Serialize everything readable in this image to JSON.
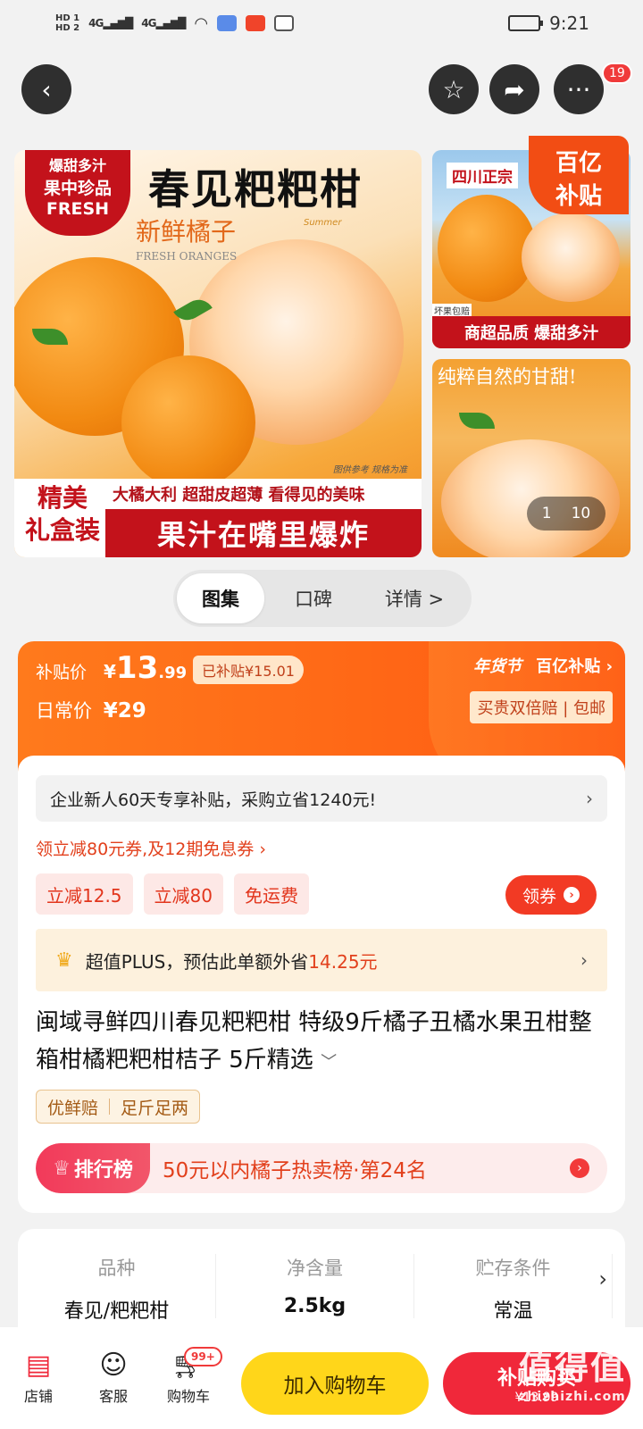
{
  "status_bar": {
    "time": "9:21",
    "network": "4G",
    "hd1": "HD 1",
    "hd2": "HD 2"
  },
  "top_bar": {
    "notification_count": "19"
  },
  "gallery": {
    "main_image": {
      "title": "春见粑粑柑",
      "corner_tag_line1": "爆甜多汁",
      "corner_tag_line2": "果中珍品",
      "corner_tag_line3": "FRESH",
      "box_text": "新鲜橘子",
      "box_subtext": "FRESH ORANGES",
      "sun_label": "Summer",
      "slogan_small": "大橘大利 超甜皮超薄 看得见的美味",
      "slogan_big": "果汁在嘴里爆炸",
      "gift_line1": "精美",
      "gift_line2": "礼盒装",
      "disclaimer": "图供参考 规格为准"
    },
    "side_image_1": {
      "top_text": "四川正宗",
      "bottom_text": "商超品质 爆甜多汁",
      "small_label": "坏果包赔"
    },
    "side_image_2": {
      "top_text": "纯粹自然的甘甜!"
    },
    "subsidy_corner": {
      "line1": "百亿",
      "line2": "补贴"
    },
    "counter_current": "1",
    "counter_total": "10"
  },
  "tabs": {
    "items": [
      "图集",
      "口碑",
      "详情 >"
    ]
  },
  "price": {
    "subsidy_label": "补贴价",
    "currency": "¥",
    "price_int": "13",
    "price_dec": ".99",
    "subsidized": "已补贴¥15.01",
    "daily_label": "日常价",
    "daily_price": "¥29",
    "festival": "年货节",
    "program": "百亿补贴",
    "guarantee": "买贵双倍赔 | 包邮"
  },
  "offers": {
    "newcomer": "企业新人60天专享补贴，采购立省1240元!",
    "coupon_line": "领立减80元券,及12期免息券 ›",
    "chips": [
      "立减12.5",
      "立减80",
      "免运费"
    ],
    "get_coupon": "领券",
    "plus_text": "超值PLUS，预估此单额外省",
    "plus_amount": "14.25元"
  },
  "product": {
    "title": "闽域寻鲜四川春见粑粑柑 特级9斤橘子丑橘水果丑柑整箱柑橘粑粑柑桔子 5斤精选",
    "tags": [
      "优鲜赔",
      "足斤足两"
    ],
    "rank_label": "排行榜",
    "rank_text": "50元以内橘子热卖榜·第24名"
  },
  "specs": [
    {
      "key": "品种",
      "value": "春见/粑粑柑"
    },
    {
      "key": "净含量",
      "value": "2.5kg"
    },
    {
      "key": "贮存条件",
      "value": "常温"
    }
  ],
  "bottom_bar": {
    "store": "店铺",
    "service": "客服",
    "cart": "购物车",
    "cart_badge": "99+",
    "add_cart": "加入购物车",
    "buy_now": "补贴购买",
    "buy_price": "¥13.99",
    "watermark": "值得值",
    "watermark_url": "zhizhizhi.com"
  },
  "colors": {
    "accent": "#ff5a12",
    "red": "#f0283a",
    "yellow": "#ffd61a"
  }
}
